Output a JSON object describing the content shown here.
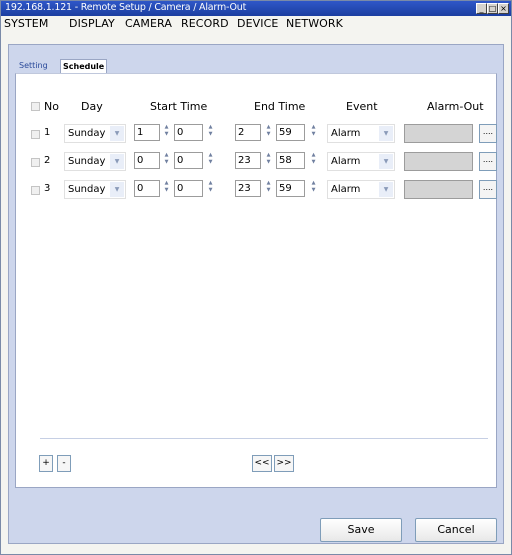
{
  "window": {
    "title": "192.168.1.121 - Remote Setup / Camera / Alarm-Out",
    "buttons": {
      "minimize": "_",
      "maximize": "□",
      "close": "×"
    }
  },
  "menu": [
    "SYSTEM",
    "DISPLAY",
    "CAMERA",
    "RECORD",
    "DEVICE",
    "NETWORK"
  ],
  "tabs": [
    {
      "label": "Setting",
      "active": false
    },
    {
      "label": "Schedule",
      "active": true
    }
  ],
  "table": {
    "headers": {
      "no": "No",
      "day": "Day",
      "start_time": "Start Time",
      "end_time": "End Time",
      "event": "Event",
      "alarm_out": "Alarm-Out"
    },
    "rows": [
      {
        "no": "1",
        "day": "Sunday",
        "start_h": "1",
        "start_m": "0",
        "end_h": "2",
        "end_m": "59",
        "event": "Alarm",
        "alarm_out": "",
        "checked": false
      },
      {
        "no": "2",
        "day": "Sunday",
        "start_h": "0",
        "start_m": "0",
        "end_h": "23",
        "end_m": "58",
        "event": "Alarm",
        "alarm_out": "",
        "checked": false
      },
      {
        "no": "3",
        "day": "Sunday",
        "start_h": "0",
        "start_m": "0",
        "end_h": "23",
        "end_m": "59",
        "event": "Alarm",
        "alarm_out": "",
        "checked": false
      }
    ],
    "browse_label": "...."
  },
  "controls": {
    "add": "+",
    "remove": "-",
    "prev": "<<",
    "next": ">>"
  },
  "footer": {
    "save": "Save",
    "cancel": "Cancel"
  }
}
